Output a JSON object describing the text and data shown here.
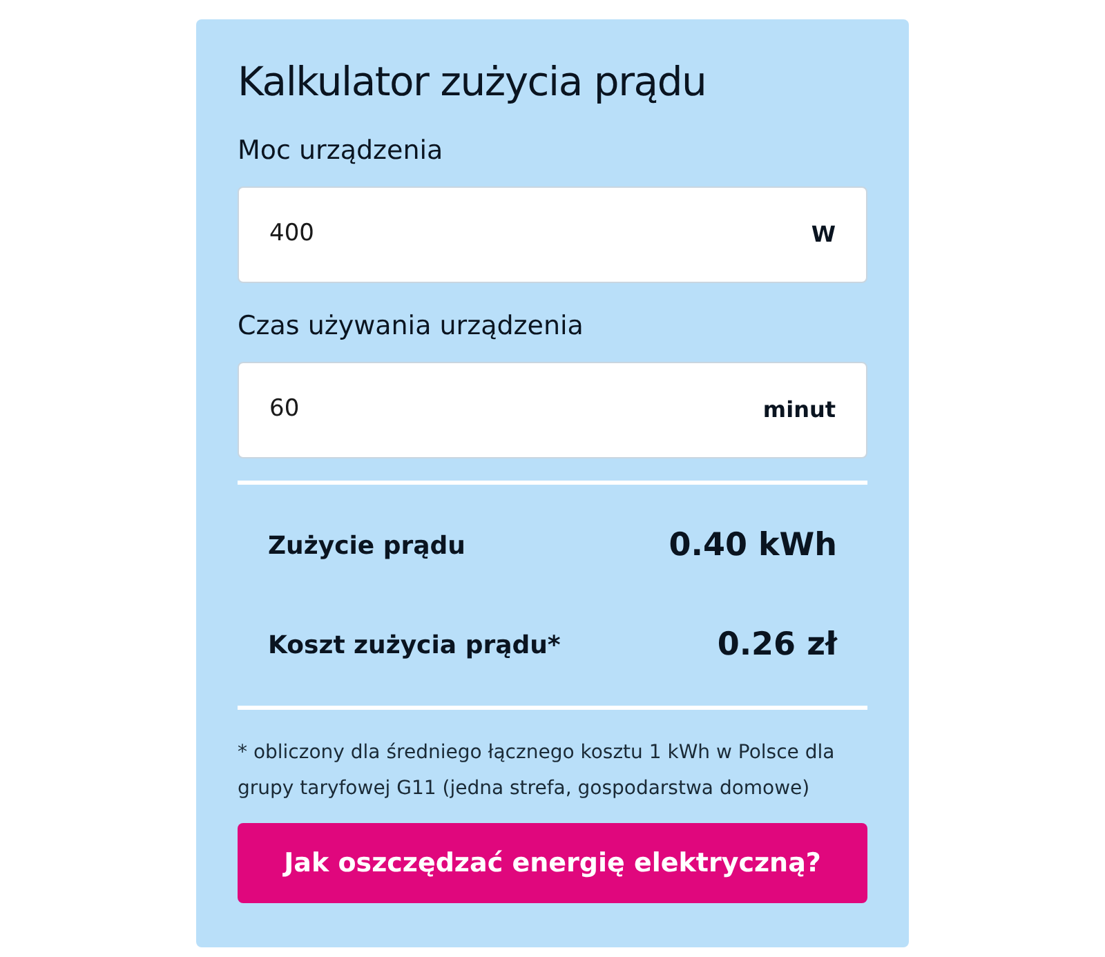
{
  "title": "Kalkulator zużycia prądu",
  "fields": [
    {
      "label": "Moc urządzenia",
      "value": "400",
      "unit": "W"
    },
    {
      "label": "Czas używania urządzenia",
      "value": "60",
      "unit": "minut"
    }
  ],
  "results": [
    {
      "label": "Zużycie prądu",
      "value": "0.40 kWh"
    },
    {
      "label": "Koszt zużycia prądu*",
      "value": "0.26 zł"
    }
  ],
  "footnote": "* obliczony dla średniego łącznego kosztu 1 kWh w Polsce dla grupy taryfowej G11 (jedna strefa, gospodarstwa domowe)",
  "button": "Jak oszczędzać energię elektryczną?"
}
